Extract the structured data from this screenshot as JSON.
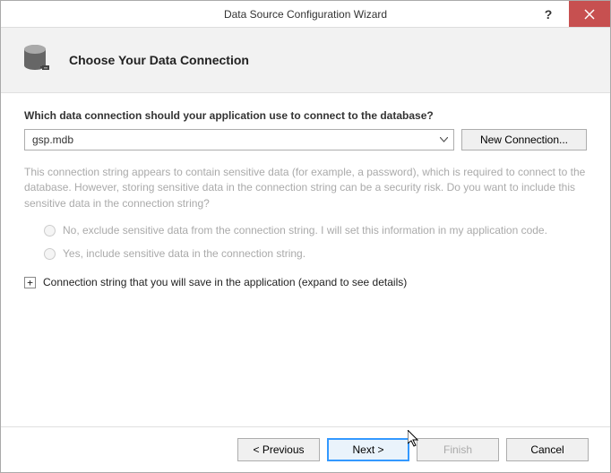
{
  "window": {
    "title": "Data Source Configuration Wizard"
  },
  "header": {
    "title": "Choose Your Data Connection"
  },
  "content": {
    "question": "Which data connection should your application use to connect to the database?",
    "selectedConnection": "gsp.mdb",
    "newConnectionLabel": "New Connection...",
    "sensitiveWarning": "This connection string appears to contain sensitive data (for example, a password), which is required to connect to the database. However, storing sensitive data in the connection string can be a security risk. Do you want to include this sensitive data in the connection string?",
    "radioNo": "No, exclude sensitive data from the connection string. I will set this information in my application code.",
    "radioYes": "Yes, include sensitive data in the connection string.",
    "expanderLabel": "Connection string that you will save in the application (expand to see details)"
  },
  "footer": {
    "previous": "< Previous",
    "next": "Next >",
    "finish": "Finish",
    "cancel": "Cancel"
  }
}
